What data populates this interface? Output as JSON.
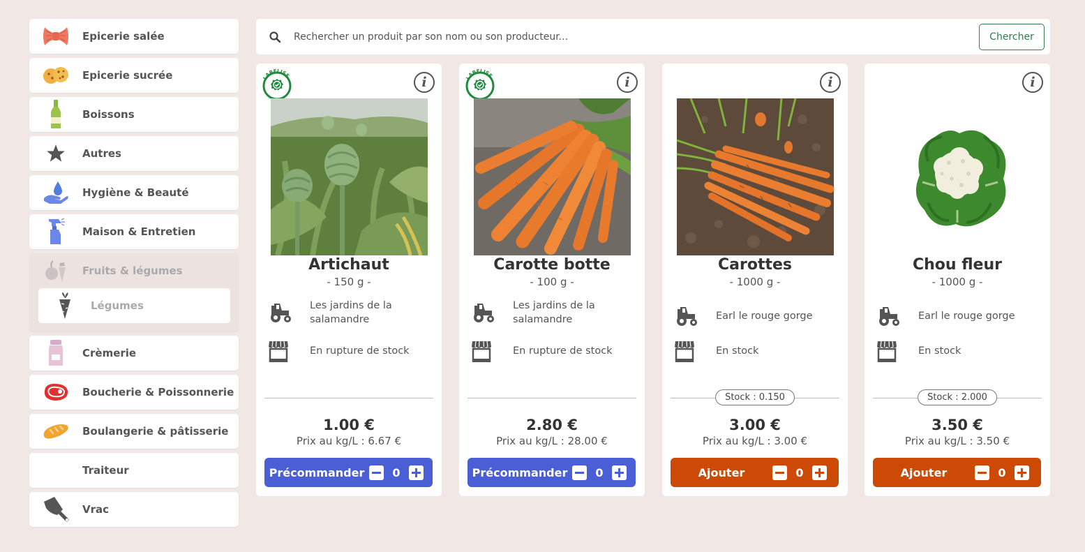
{
  "sidebar": {
    "categories": [
      {
        "label": "Epicerie salée",
        "icon": "pasta-icon"
      },
      {
        "label": "Epicerie sucrée",
        "icon": "cookie-icon"
      },
      {
        "label": "Boissons",
        "icon": "bottle-icon"
      },
      {
        "label": "Autres",
        "icon": "star-icon"
      },
      {
        "label": "Hygiène & Beauté",
        "icon": "water-drop-hand-icon"
      },
      {
        "label": "Maison & Entretien",
        "icon": "spray-bottle-icon"
      },
      {
        "label": "Fruits & légumes",
        "icon": "fruits-vegetables-icon",
        "expanded": true,
        "subcategories": [
          {
            "label": "Légumes",
            "icon": "carrot-icon"
          }
        ]
      },
      {
        "label": "Crèmerie",
        "icon": "milk-jar-icon"
      },
      {
        "label": "Boucherie & Poissonnerie",
        "icon": "meat-icon"
      },
      {
        "label": "Boulangerie & pâtisserie",
        "icon": "bread-icon"
      },
      {
        "label": "Traiteur",
        "icon": ""
      },
      {
        "label": "Vrac",
        "icon": "scoop-icon"
      }
    ]
  },
  "search": {
    "placeholder": "Rechercher un produit par son nom ou son producteur...",
    "button_label": "Chercher"
  },
  "products": [
    {
      "name": "Artichaut",
      "weight": "- 150 g -",
      "labelise": true,
      "badge_text": "LABELISE",
      "producer": "Les jardins de la salamandre",
      "stock_status": "En rupture de stock",
      "stock_pill": "",
      "price": "1.00 €",
      "price_per_kg": "Prix au kg/L : 6.67 €",
      "action_label": "Précommander",
      "action_color": "#4a5fd6",
      "quantity": "0"
    },
    {
      "name": "Carotte botte",
      "weight": "- 100 g -",
      "labelise": true,
      "badge_text": "LABELISE",
      "producer": "Les jardins de la salamandre",
      "stock_status": "En rupture de stock",
      "stock_pill": "",
      "price": "2.80 €",
      "price_per_kg": "Prix au kg/L : 28.00 €",
      "action_label": "Précommander",
      "action_color": "#4a5fd6",
      "quantity": "0"
    },
    {
      "name": "Carottes",
      "weight": "- 1000 g -",
      "labelise": false,
      "producer": "Earl le rouge gorge",
      "stock_status": "En stock",
      "stock_pill": "Stock : 0.150",
      "price": "3.00 €",
      "price_per_kg": "Prix au kg/L : 3.00 €",
      "action_label": "Ajouter",
      "action_color": "#cc4a05",
      "quantity": "0"
    },
    {
      "name": "Chou fleur",
      "weight": "- 1000 g -",
      "labelise": false,
      "producer": "Earl le rouge gorge",
      "stock_status": "En stock",
      "stock_pill": "Stock : 2.000",
      "price": "3.50 €",
      "price_per_kg": "Prix au kg/L : 3.50 €",
      "action_label": "Ajouter",
      "action_color": "#cc4a05",
      "quantity": "0"
    }
  ],
  "colors": {
    "background": "#f1e8e6",
    "label_green": "#1e8a3c",
    "preorder_blue": "#4a5fd6",
    "add_orange": "#cc4a05",
    "search_button_green": "#2e7d4f"
  }
}
